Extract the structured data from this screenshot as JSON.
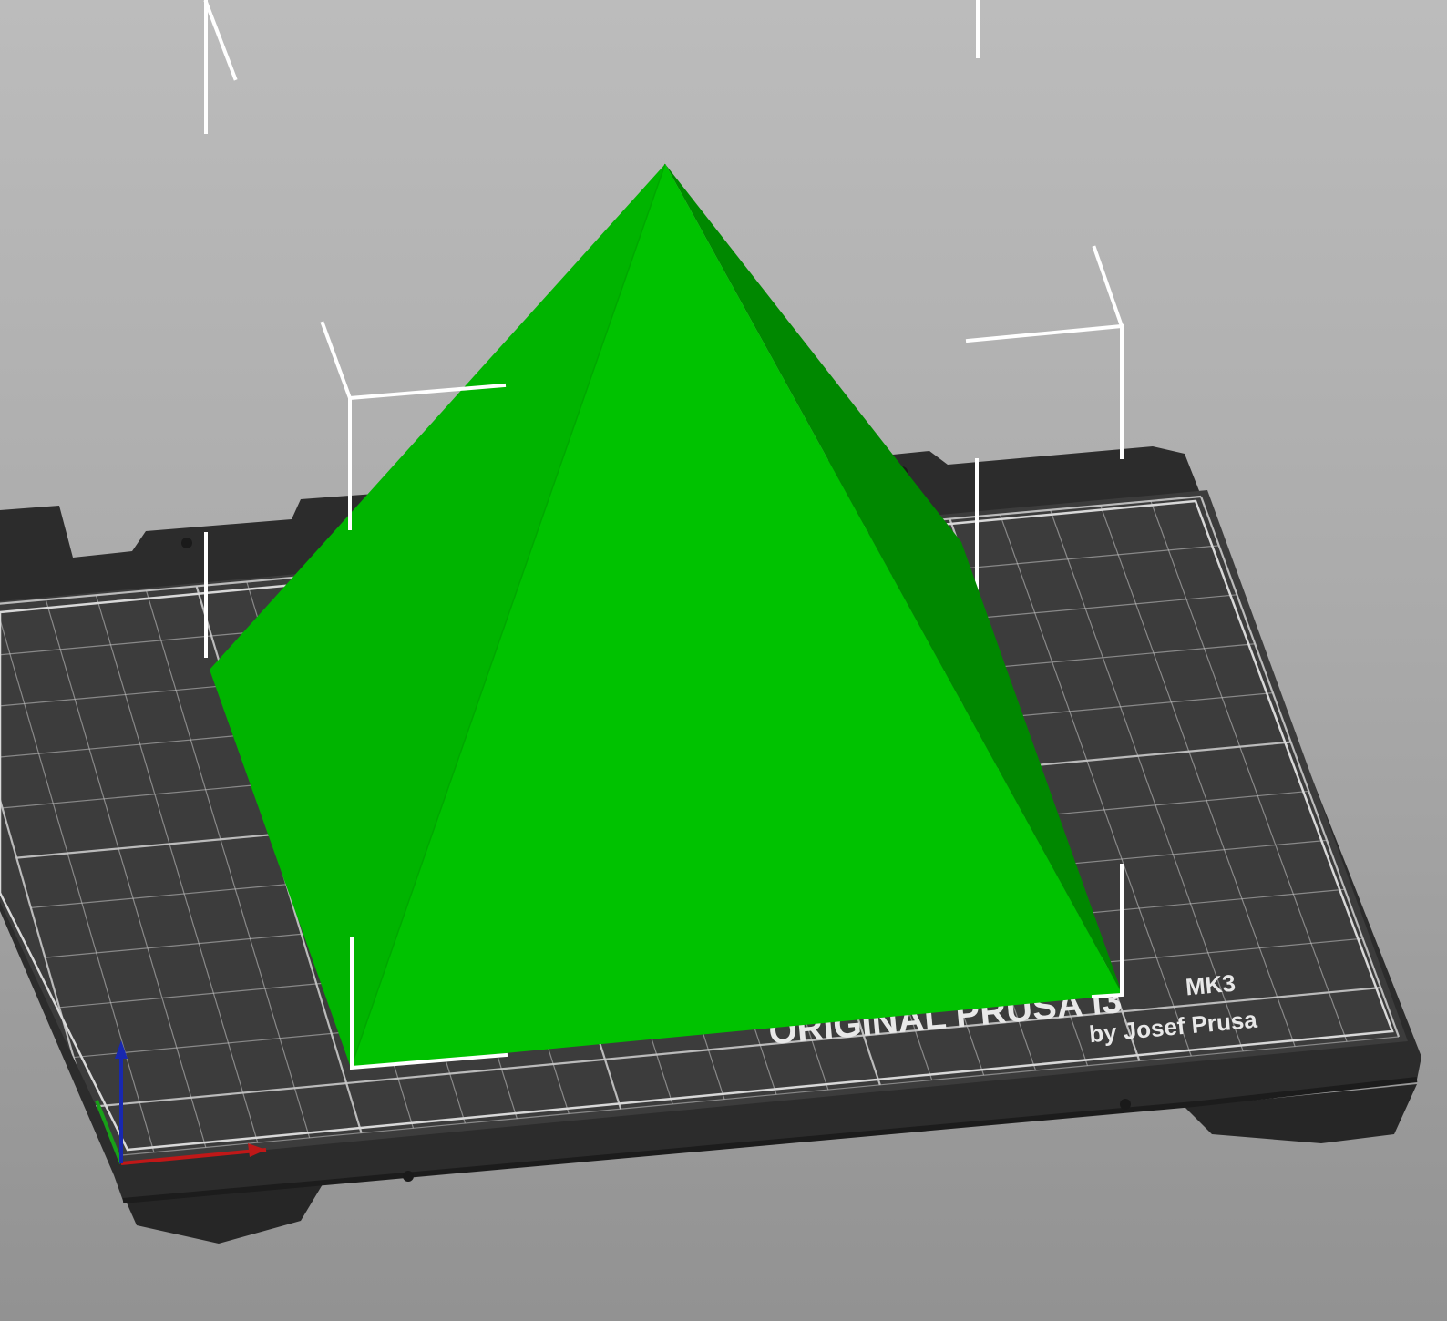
{
  "viewport": {
    "background_top": "#bcbcbc",
    "background_bottom": "#929292"
  },
  "bed": {
    "surface_color": "#3b3b3b",
    "frame_color": "#2a2a2a",
    "grid_color": "#c9c9c9",
    "brand_text": "ORIGINAL PRUSA i3",
    "model_text": "MK3",
    "byline_text": "by Josef Prusa"
  },
  "object": {
    "name": "pyramid",
    "color_face_front": "#00c000",
    "color_face_left": "#00b000",
    "color_face_right": "#008a00",
    "selected": true
  },
  "axes": {
    "x_color": "#c01818",
    "y_color": "#18a018",
    "z_color": "#1828b0"
  }
}
